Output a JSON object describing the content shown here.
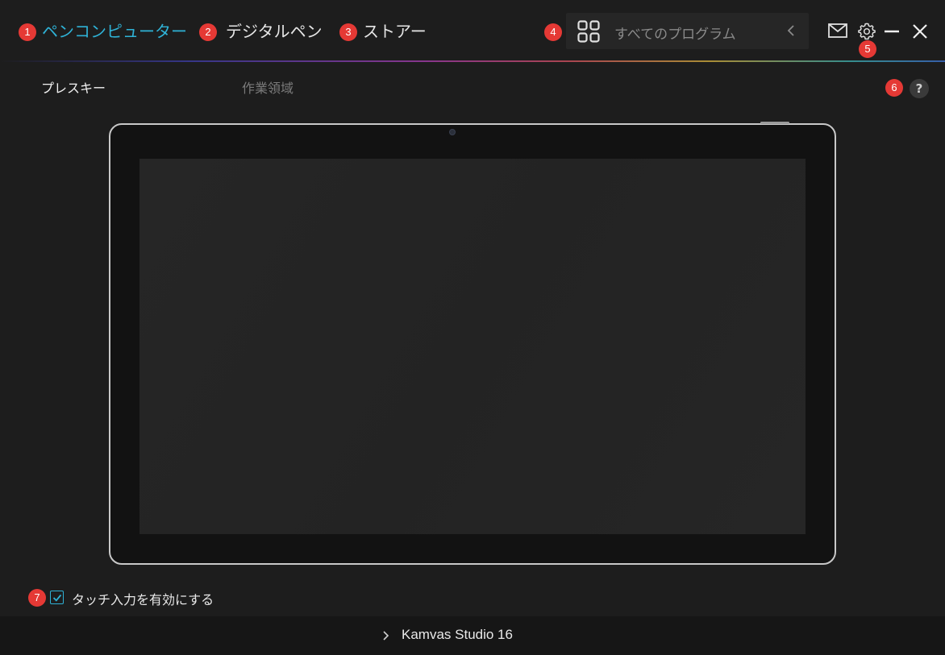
{
  "tabs": [
    {
      "badge": "1",
      "label": "ペンコンピューター",
      "active": true
    },
    {
      "badge": "2",
      "label": "デジタルペン",
      "active": false
    },
    {
      "badge": "3",
      "label": "ストアー",
      "active": false
    }
  ],
  "program_selector": {
    "badge": "4",
    "label": "すべてのプログラム",
    "icon": "grid-icon"
  },
  "toolbar": {
    "settings_badge": "5",
    "mail_icon": "mail-icon",
    "settings_icon": "gear-icon",
    "minimize_icon": "minimize-icon",
    "close_icon": "close-icon"
  },
  "subtabs": [
    {
      "label": "プレスキー",
      "active": true
    },
    {
      "label": "作業領域",
      "active": false
    }
  ],
  "help": {
    "badge": "6",
    "label": "?"
  },
  "touch": {
    "badge": "7",
    "label": "タッチ入力を有効にする",
    "checked": true
  },
  "footer": {
    "device_label": "Kamvas Studio 16"
  },
  "colors": {
    "accent": "#2fb2d6",
    "badge": "#e53935",
    "background": "#1d1d1d"
  }
}
